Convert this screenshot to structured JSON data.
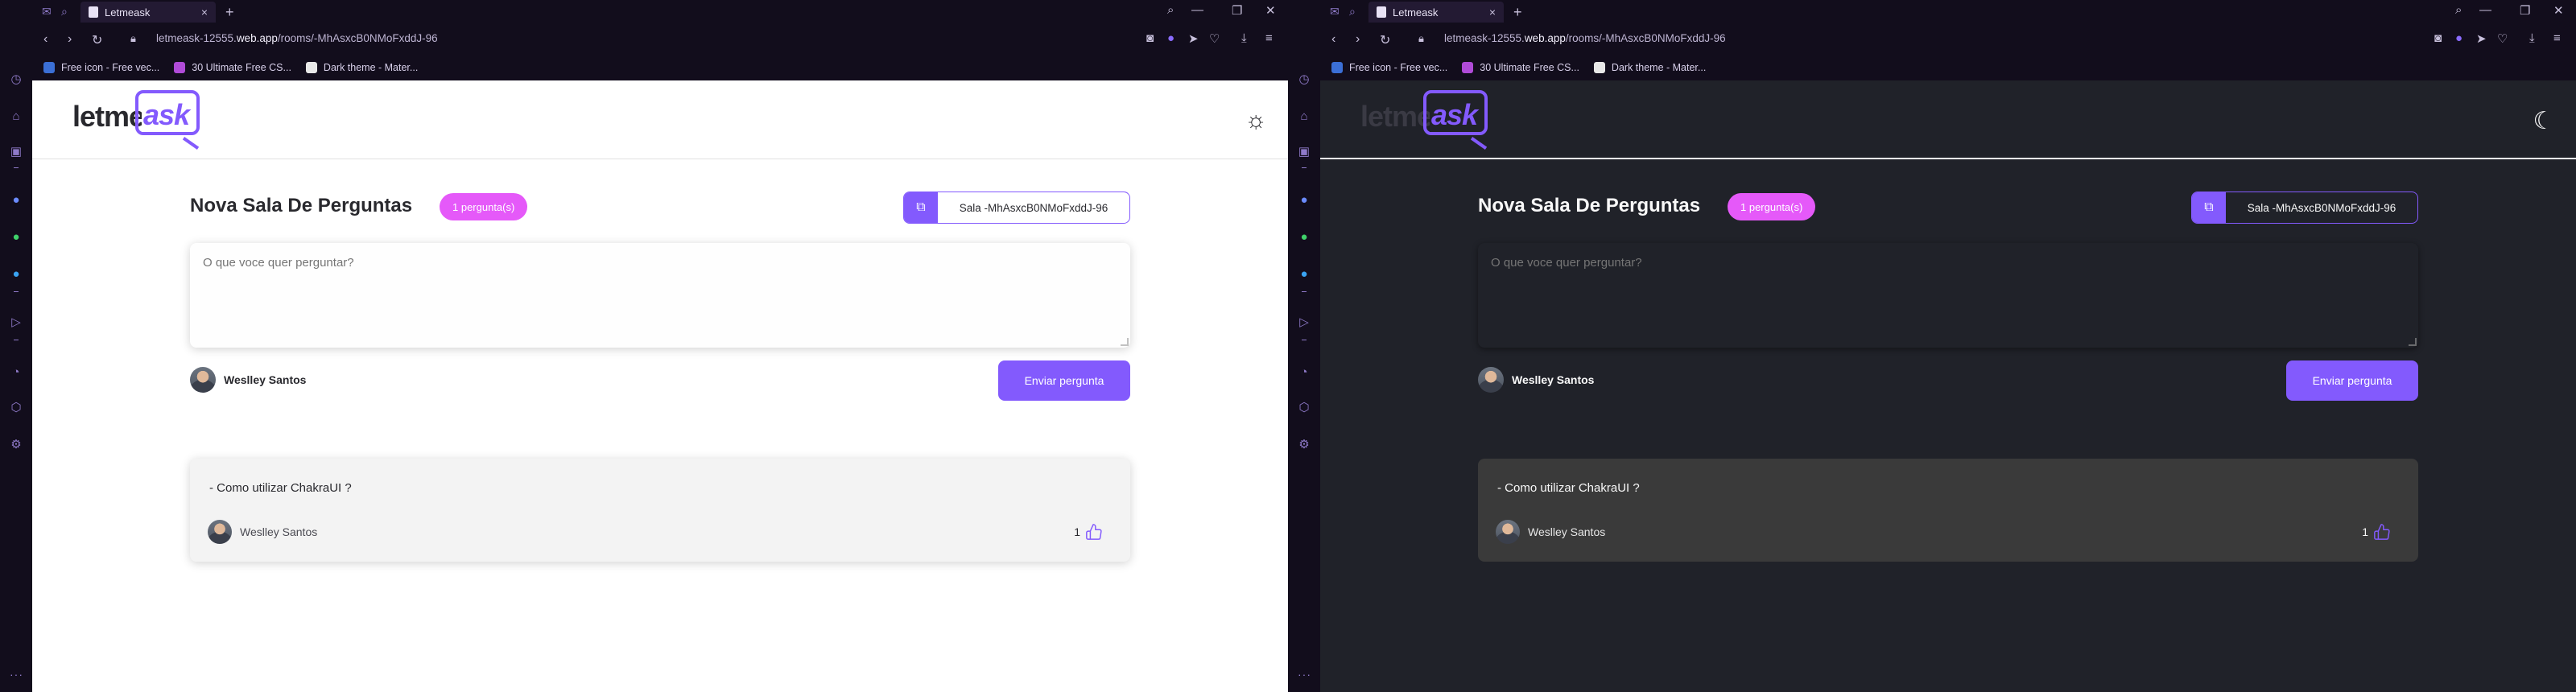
{
  "browser": {
    "tab_title": "Letmeask",
    "tab_close": "×",
    "new_tab": "+",
    "url_prefix": "letmeask-12555.",
    "url_domain": "web.app",
    "url_path": "/rooms/-MhAsxcB0NMoFxddJ-96",
    "bookmarks": [
      {
        "label": "Free icon - Free vec...",
        "color": "#3b6fd6"
      },
      {
        "label": "30 Ultimate Free CS...",
        "color": "#b04bd8"
      },
      {
        "label": "Dark theme - Mater...",
        "color": "#e8e8e8"
      }
    ]
  },
  "app": {
    "logo_prefix": "letme",
    "logo_accent": "ask",
    "room_title": "Nova Sala De Perguntas",
    "question_count": "1 pergunta(s)",
    "room_code": "Sala -MhAsxcB0NMoFxddJ-96",
    "question_placeholder": "O que voce quer perguntar?",
    "user_name": "Weslley Santos",
    "send_button": "Enviar pergunta",
    "questions": [
      {
        "content": "- Como utilizar ChakraUI ?",
        "author": "Weslley Santos",
        "likes": "1"
      }
    ],
    "colors": {
      "accent": "#835afd",
      "badge": "#e559f9",
      "light_bg": "#ffffff",
      "dark_bg": "#202229"
    }
  },
  "themes": {
    "left": "light",
    "right": "dark",
    "left_toggle_icon": "sun-icon",
    "right_toggle_icon": "moon-icon"
  }
}
